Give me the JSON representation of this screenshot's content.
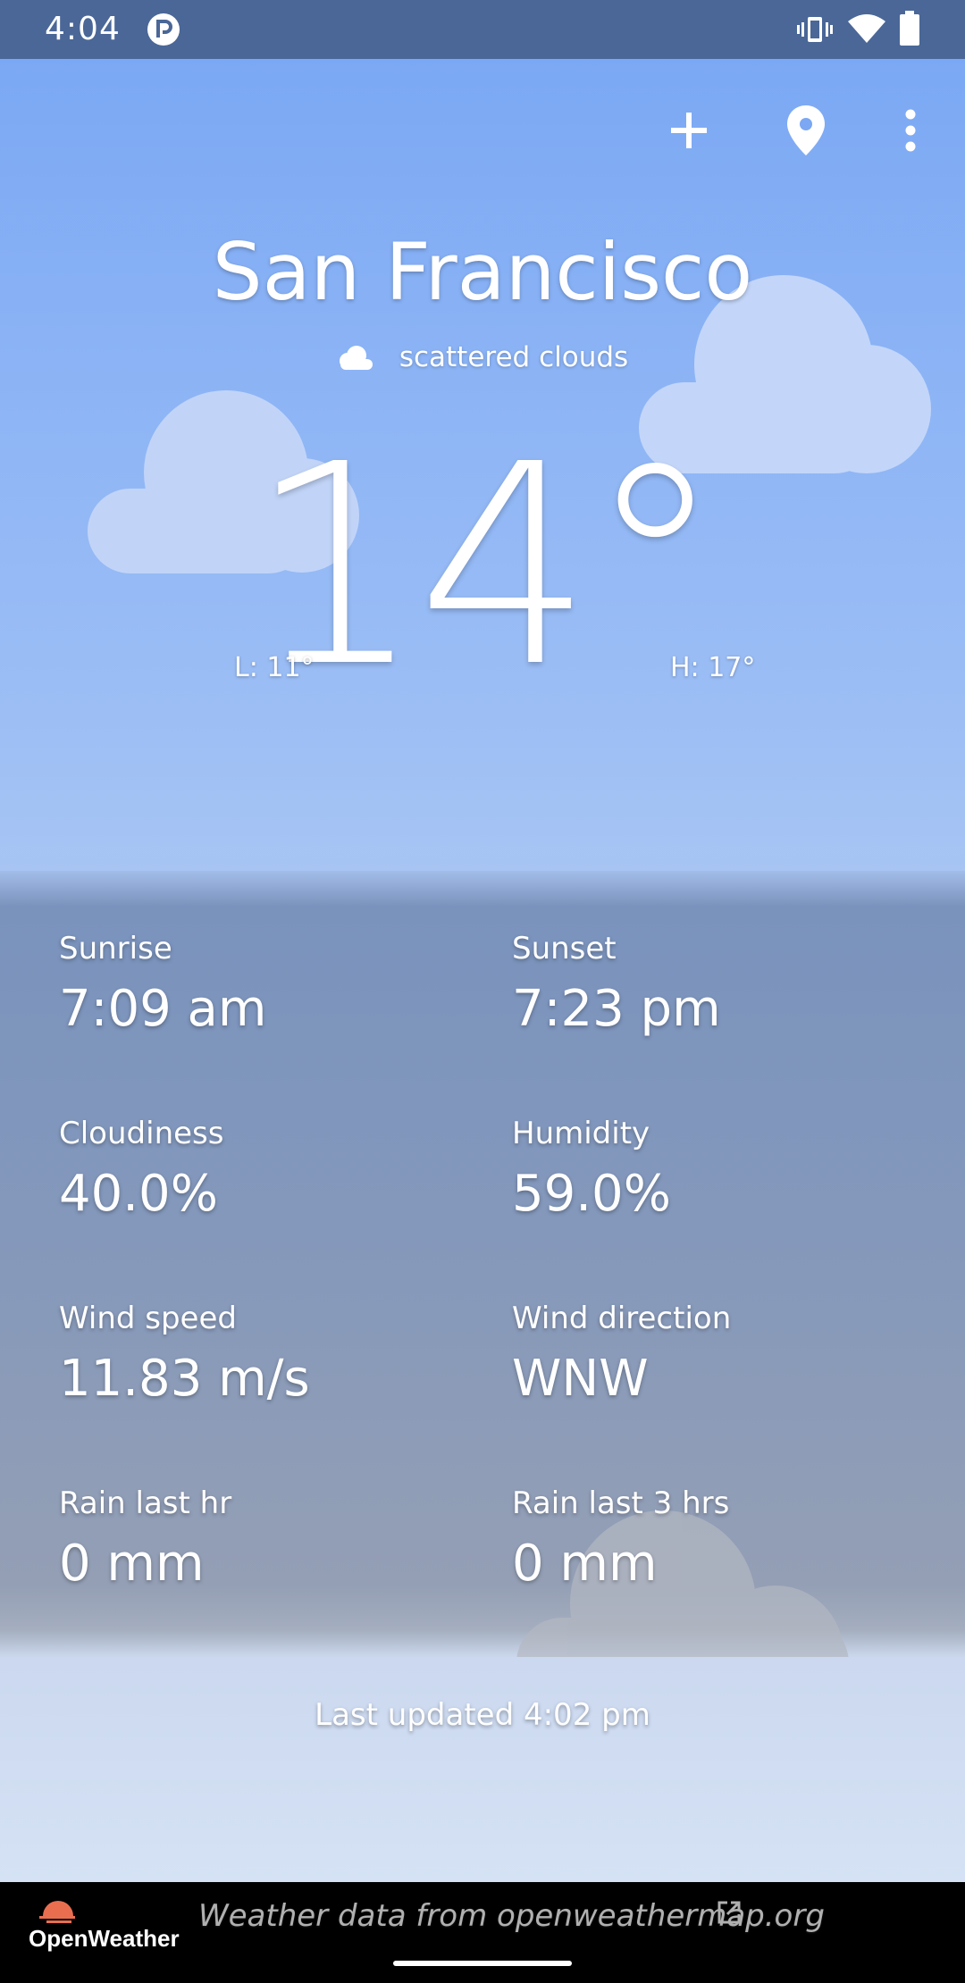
{
  "status_bar": {
    "time": "4:04",
    "icons": [
      "app-notification-icon",
      "vibrate-icon",
      "wifi-icon",
      "battery-icon"
    ]
  },
  "toolbar": {
    "icons": [
      "add-icon",
      "location-pin-icon",
      "more-vert-icon"
    ]
  },
  "weather": {
    "city": "San Francisco",
    "condition": "scattered clouds",
    "temperature": "14°",
    "low": "L: 11°",
    "high": "H: 17°"
  },
  "details": [
    {
      "label": "Sunrise",
      "value": "7:09 am"
    },
    {
      "label": "Sunset",
      "value": "7:23 pm"
    },
    {
      "label": "Cloudiness",
      "value": "40.0%"
    },
    {
      "label": "Humidity",
      "value": "59.0%"
    },
    {
      "label": "Wind speed",
      "value": "11.83 m/s"
    },
    {
      "label": "Wind direction",
      "value": "WNW"
    },
    {
      "label": "Rain last hr",
      "value": "0 mm"
    },
    {
      "label": "Rain last 3 hrs",
      "value": "0 mm"
    }
  ],
  "last_updated": "Last updated 4:02 pm",
  "footer": {
    "brand": "OpenWeather",
    "attribution": "Weather data from openweathermap.org"
  },
  "colors": {
    "sky_top": "#78a6f4",
    "status_bar": "#4a6797",
    "panel": "#8498bb",
    "footer": "#000000",
    "brand_accent": "#e96e50"
  }
}
